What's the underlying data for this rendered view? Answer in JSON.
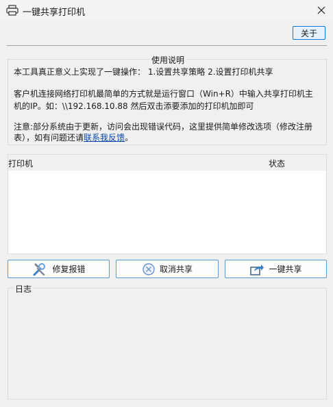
{
  "window": {
    "title": "一键共享打印机"
  },
  "toolbar": {
    "about_label": "关于"
  },
  "usage": {
    "title": "使用说明",
    "line1": "本工具真正意义上实现了一键操作：   1.设置共享策略  2.设置打印机共享",
    "line2": "客户机连接网络打印机最简单的方式就是运行窗口（Win+R）中输入共享打印机主",
    "line3": "机的IP。如：\\\\192.168.10.88 然后双击添要添加的打印机加即可",
    "line4": "注意:部分系统由于更新，访问会出现错误代码，这里提供简单修改选项（修改注册",
    "line5_prefix": "表），如有问题还请",
    "line5_link": "联系我反馈",
    "line5_suffix": "。"
  },
  "printer_list": {
    "columns": [
      "打印机",
      "状态"
    ],
    "rows": []
  },
  "actions": {
    "repair_label": "修复报错",
    "cancel_label": "取消共享",
    "share_label": "一键共享"
  },
  "log": {
    "title": "日志",
    "content": ""
  },
  "colors": {
    "accent_border": "#0078d7",
    "button_border": "#5b9bd5",
    "link": "#0645ad"
  }
}
